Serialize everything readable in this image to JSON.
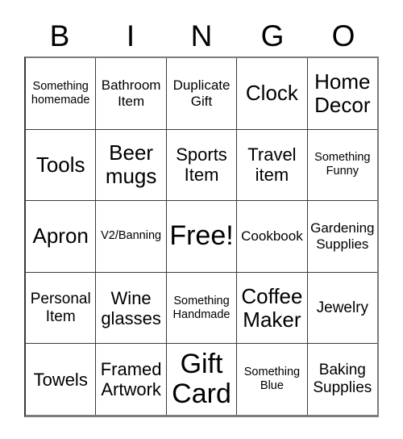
{
  "card": {
    "title": "BINGO",
    "header_letters": [
      "B",
      "I",
      "N",
      "G",
      "O"
    ],
    "grid_size": "5x5",
    "colors": {
      "background": "#ffffff",
      "text": "#000000",
      "gridline": "#3b3b3b",
      "outer_border": "#7c7c7c"
    },
    "rows": [
      [
        {
          "text": "Something homemade",
          "size": "xxs"
        },
        {
          "text": "Bathroom Item",
          "size": "xs"
        },
        {
          "text": "Duplicate Gift",
          "size": "xs"
        },
        {
          "text": "Clock",
          "size": "lg"
        },
        {
          "text": "Home Decor",
          "size": "lg"
        }
      ],
      [
        {
          "text": "Tools",
          "size": "lg"
        },
        {
          "text": "Beer mugs",
          "size": "lg"
        },
        {
          "text": "Sports Item",
          "size": "md"
        },
        {
          "text": "Travel item",
          "size": "md"
        },
        {
          "text": "Something Funny",
          "size": "xxs"
        }
      ],
      [
        {
          "text": "Apron",
          "size": "lg"
        },
        {
          "text": "V2/Banning",
          "size": "xxs"
        },
        {
          "text": "Free!",
          "size": "xxl"
        },
        {
          "text": "Cookbook",
          "size": "xs"
        },
        {
          "text": "Gardening Supplies",
          "size": "xs"
        }
      ],
      [
        {
          "text": "Personal Item",
          "size": "sm"
        },
        {
          "text": "Wine glasses",
          "size": "md"
        },
        {
          "text": "Something Handmade",
          "size": "xxs"
        },
        {
          "text": "Coffee Maker",
          "size": "lg"
        },
        {
          "text": "Jewelry",
          "size": "sm"
        }
      ],
      [
        {
          "text": "Towels",
          "size": "md"
        },
        {
          "text": "Framed Artwork",
          "size": "md"
        },
        {
          "text": "Gift Card",
          "size": "xxl"
        },
        {
          "text": "Something Blue",
          "size": "xxs"
        },
        {
          "text": "Baking Supplies",
          "size": "sm"
        }
      ]
    ]
  }
}
